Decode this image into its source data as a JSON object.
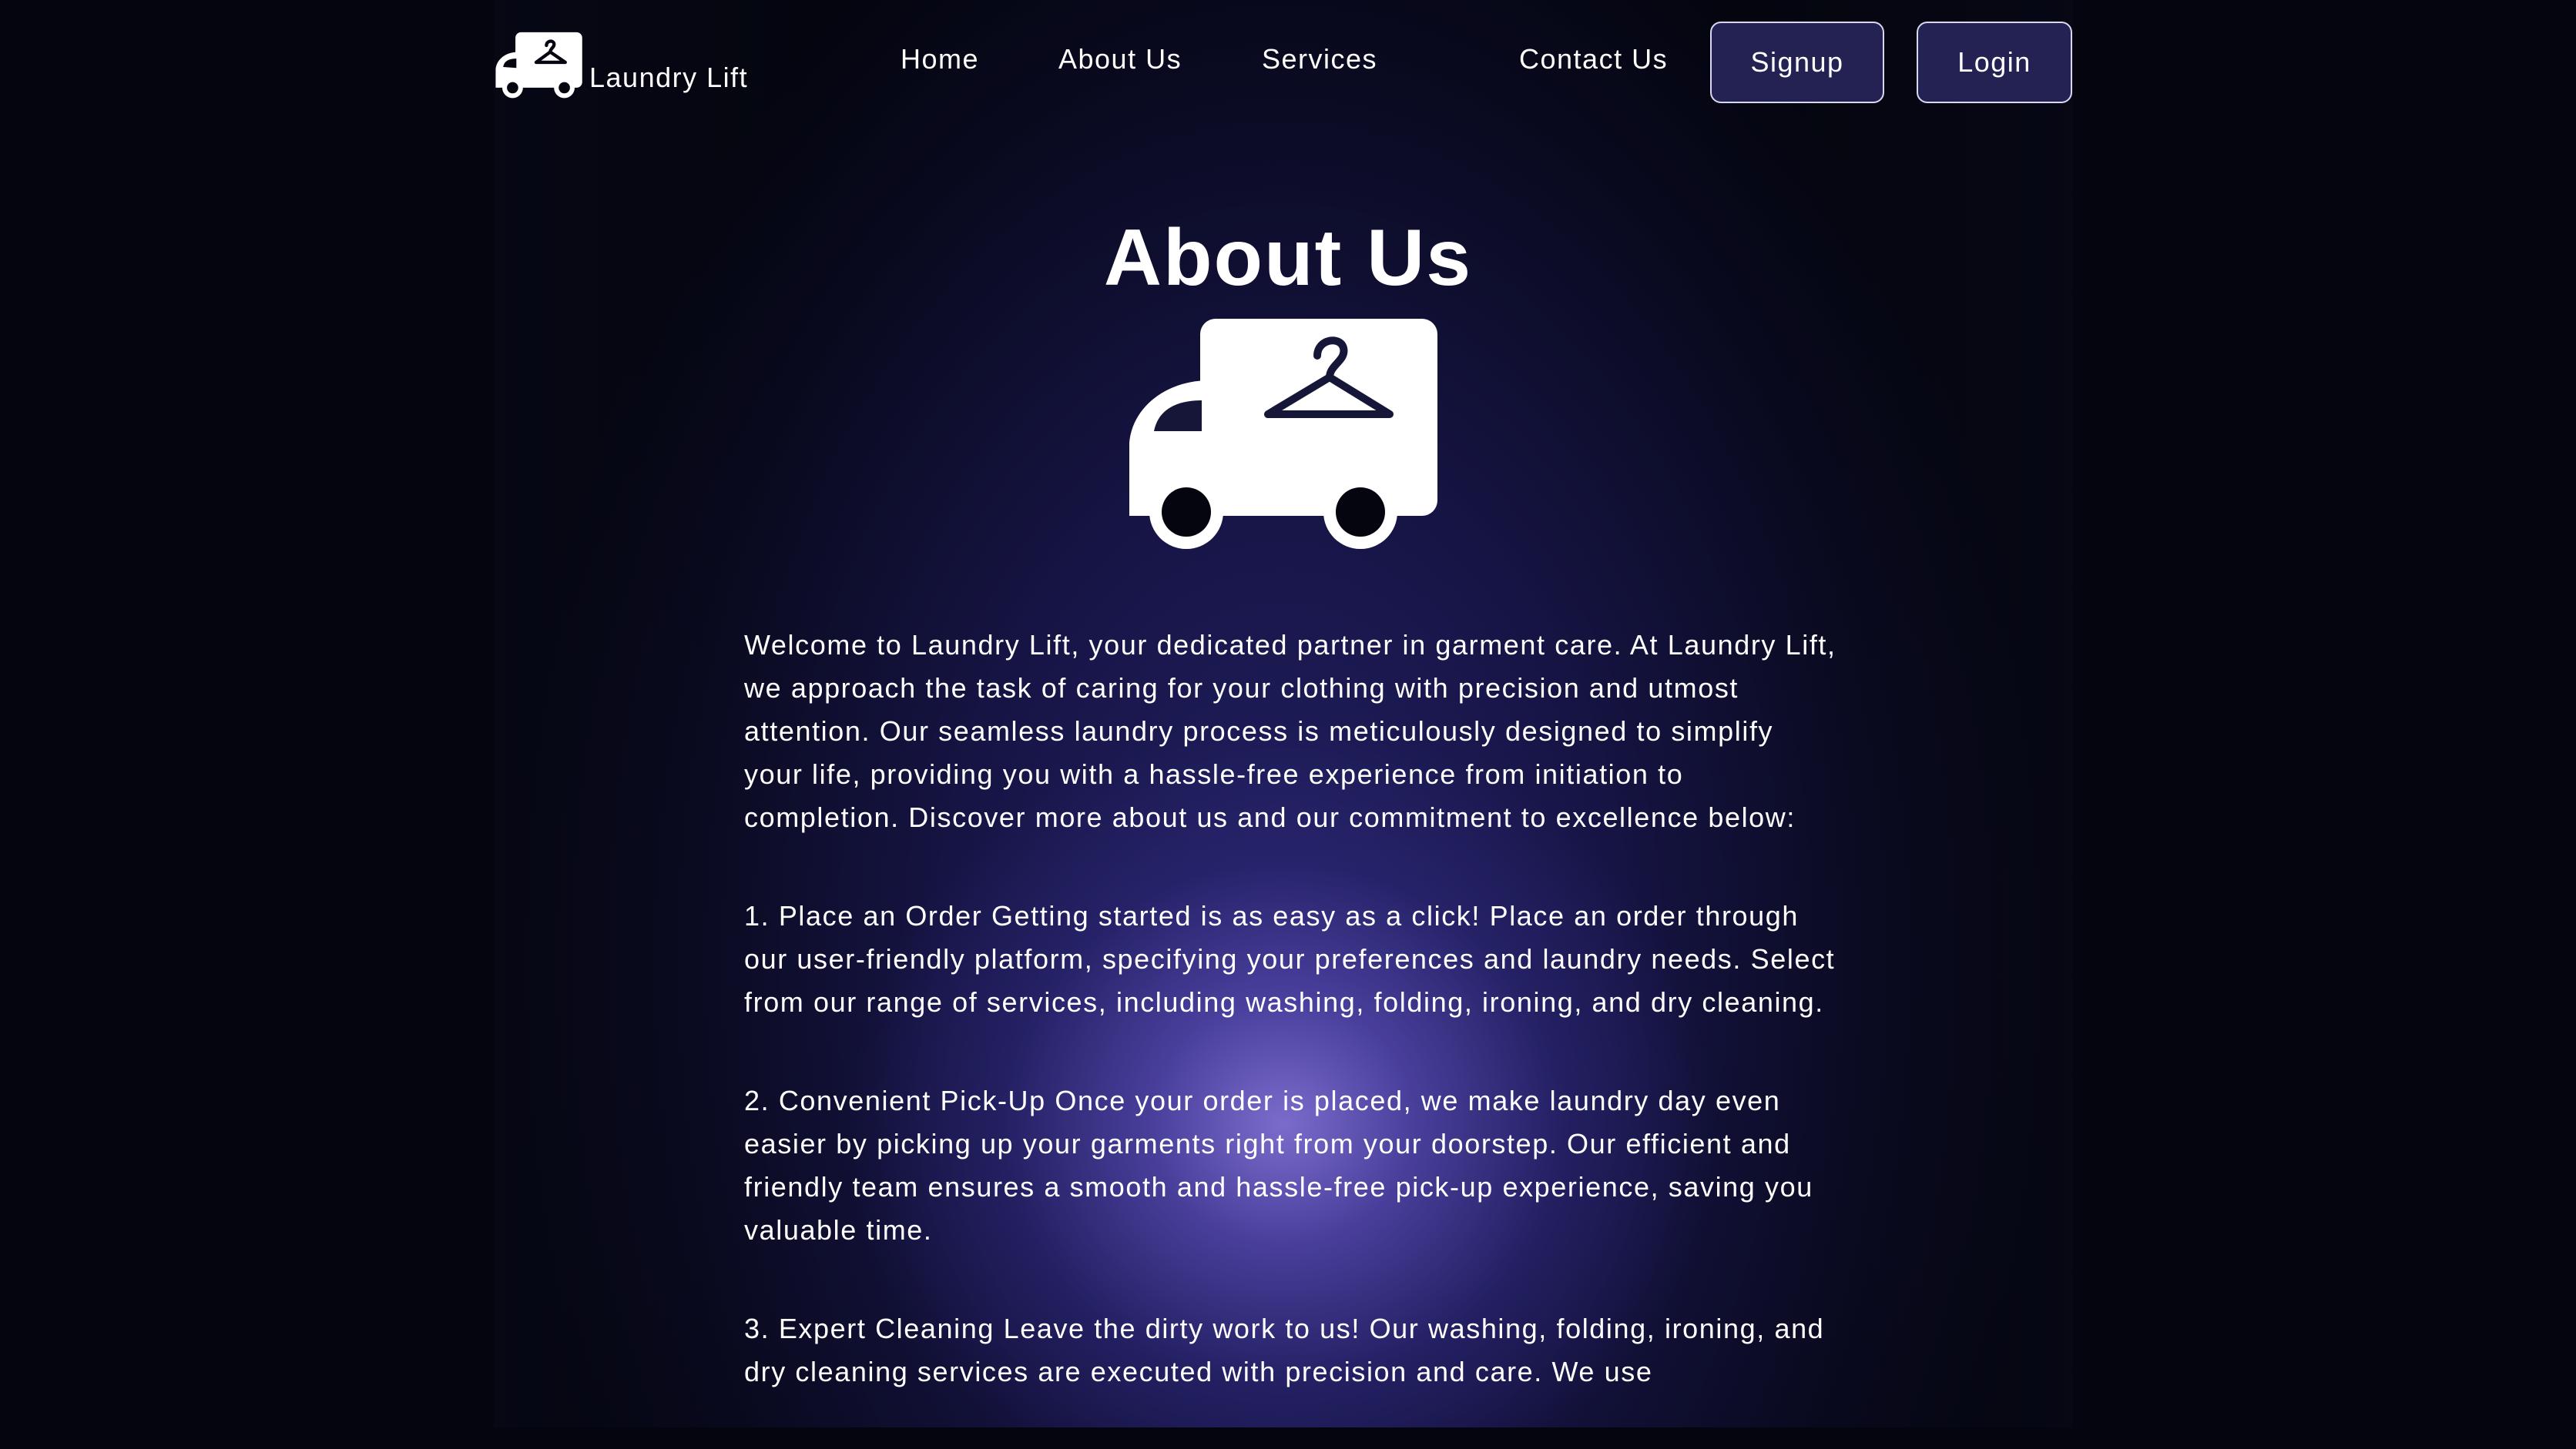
{
  "brand": {
    "name": "Laundry Lift",
    "logo_icon": "laundry-van-hanger-icon"
  },
  "nav": {
    "links": [
      "Home",
      "About Us",
      "Services",
      "Contact Us"
    ],
    "signup_label": "Signup",
    "login_label": "Login"
  },
  "hero": {
    "title": "About Us",
    "logo_icon": "laundry-van-hanger-icon"
  },
  "content": {
    "paragraphs": [
      "Welcome to Laundry Lift, your dedicated partner in garment care. At Laundry Lift, we approach the task of caring for your clothing with precision and utmost attention. Our seamless laundry process is meticulously designed to simplify your life, providing you with a hassle-free experience from initiation to completion. Discover more about us and our commitment to excellence below:",
      "1. Place an Order Getting started is as easy as a click! Place an order through our user-friendly platform, specifying your preferences and laundry needs. Select from our range of services, including washing, folding, ironing, and dry cleaning.",
      "2. Convenient Pick-Up Once your order is placed, we make laundry day even easier by picking up your garments right from your doorstep. Our efficient and friendly team ensures a smooth and hassle-free pick-up experience, saving you valuable time.",
      "3. Expert Cleaning Leave the dirty work to us! Our washing, folding, ironing, and dry cleaning services are executed with precision and care. We use"
    ]
  },
  "colors": {
    "background": "#04050f",
    "button_bg": "#232253",
    "glow": "#8070d2",
    "text": "#ffffff"
  }
}
